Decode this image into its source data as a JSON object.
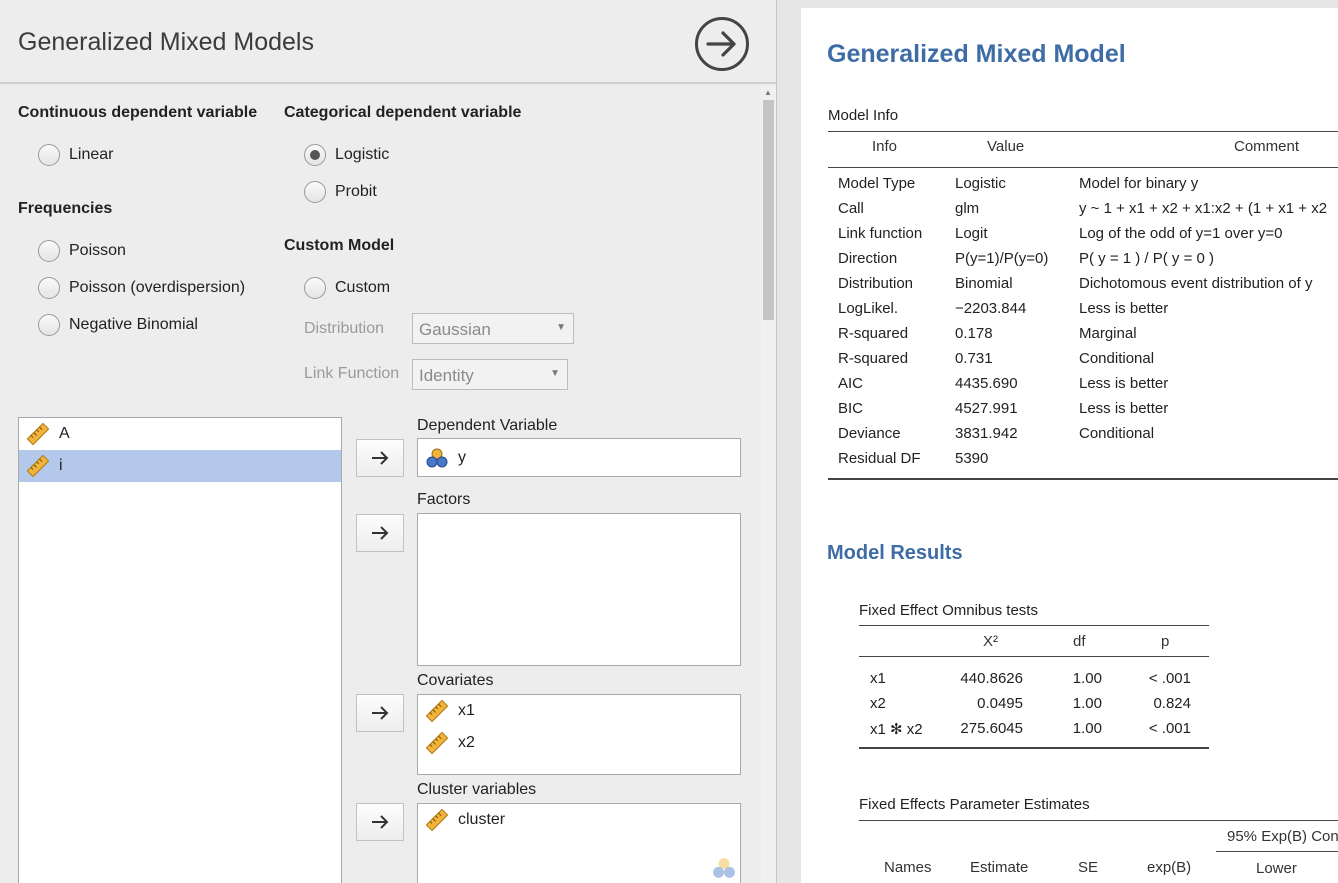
{
  "left_panel": {
    "title": "Generalized Mixed Models",
    "continuous": {
      "title": "Continuous dependent variable",
      "options": [
        "Linear"
      ]
    },
    "categorical": {
      "title": "Categorical dependent variable",
      "options": [
        "Logistic",
        "Probit"
      ],
      "selected": "Logistic"
    },
    "frequencies": {
      "title": "Frequencies",
      "options": [
        "Poisson",
        "Poisson (overdispersion)",
        "Negative Binomial"
      ]
    },
    "custom": {
      "title": "Custom Model",
      "option": "Custom",
      "distribution_label": "Distribution",
      "distribution_value": "Gaussian",
      "link_label": "Link Function",
      "link_value": "Identity"
    },
    "source_vars": [
      {
        "name": "A",
        "icon": "ruler-icon",
        "selected": false
      },
      {
        "name": "i",
        "icon": "ruler-icon",
        "selected": true
      }
    ],
    "dependent": {
      "label": "Dependent Variable",
      "items": [
        {
          "name": "y",
          "icon": "nominal-icon"
        }
      ]
    },
    "factors": {
      "label": "Factors",
      "items": []
    },
    "covariates": {
      "label": "Covariates",
      "items": [
        {
          "name": "x1",
          "icon": "ruler-icon"
        },
        {
          "name": "x2",
          "icon": "ruler-icon"
        }
      ]
    },
    "clusters": {
      "label": "Cluster variables",
      "items": [
        {
          "name": "cluster",
          "icon": "ruler-icon"
        }
      ]
    }
  },
  "results": {
    "title": "Generalized Mixed Model",
    "model_info": {
      "title": "Model Info",
      "headers": [
        "Info",
        "Value",
        "Comment"
      ],
      "rows": [
        [
          "Model Type",
          "Logistic",
          "Model for binary y"
        ],
        [
          "Call",
          "glm",
          "y ~ 1 + x1 + x2 + x1:x2 + (1 + x1 + x2"
        ],
        [
          "Link function",
          "Logit",
          "Log of the odd of y=1 over y=0"
        ],
        [
          "Direction",
          "P(y=1)/P(y=0)",
          "P( y = 1 ) / P( y = 0 )"
        ],
        [
          "Distribution",
          "Binomial",
          "Dichotomous event distribution of y"
        ],
        [
          "LogLikel.",
          "−2203.844",
          "Less is better"
        ],
        [
          "R-squared",
          "0.178",
          "Marginal"
        ],
        [
          "R-squared",
          "0.731",
          "Conditional"
        ],
        [
          "AIC",
          "4435.690",
          "Less is better"
        ],
        [
          "BIC",
          "4527.991",
          "Less is better"
        ],
        [
          "Deviance",
          "3831.942",
          "Conditional"
        ],
        [
          "Residual DF",
          "5390",
          ""
        ]
      ]
    },
    "model_results_title": "Model Results",
    "omnibus": {
      "title": "Fixed Effect Omnibus tests",
      "headers": [
        "",
        "X²",
        "df",
        "p"
      ],
      "rows": [
        [
          "x1",
          "440.8626",
          "1.00",
          "< .001"
        ],
        [
          "x2",
          "0.0495",
          "1.00",
          "0.824"
        ],
        [
          "x1 ✻ x2",
          "275.6045",
          "1.00",
          "< .001"
        ]
      ]
    },
    "estimates": {
      "title": "Fixed Effects Parameter Estimates",
      "ci_header": "95% Exp(B) Con",
      "headers": [
        "Names",
        "Estimate",
        "SE",
        "exp(B)",
        "Lower"
      ]
    }
  }
}
